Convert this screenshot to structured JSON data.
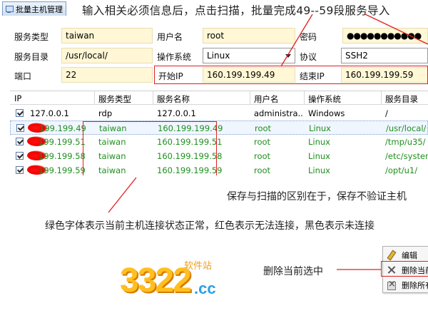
{
  "tab": {
    "label": "批量主机管理"
  },
  "headline": "输入相关必须信息后，点击扫描，批量完成49--59段服务导入",
  "form": {
    "service_type_label": "服务类型",
    "service_type_value": "taiwan",
    "username_label": "用户名",
    "username_value": "root",
    "password_label": "密码",
    "password_value": "●●●●●●●●●●●",
    "service_dir_label": "服务目录",
    "service_dir_value": "/usr/local/",
    "os_label": "操作系统",
    "os_value": "Linux",
    "protocol_label": "协议",
    "protocol_value": "SSH2",
    "port_label": "端口",
    "port_value": "22",
    "start_ip_label": "开始IP",
    "start_ip_value": "160.199.199.49",
    "end_ip_label": "结束IP",
    "end_ip_value": "160.199.199.59"
  },
  "table": {
    "headers": [
      "IP",
      "服务类型",
      "服务名称",
      "用户名",
      "操作系统",
      "服务目录"
    ],
    "rows": [
      {
        "ip": "127.0.0.1",
        "type": "rdp",
        "name": "127.0.0.1",
        "user": "administra...",
        "os": "Windows",
        "dir": "/",
        "green": false,
        "blot": false
      },
      {
        "ip": "199.199.49",
        "type": "taiwan",
        "name": "160.199.199.49",
        "user": "root",
        "os": "Linux",
        "dir": "/usr/local/",
        "green": true,
        "blot": true
      },
      {
        "ip": "199.199.51",
        "type": "taiwan",
        "name": "160.199.199.51",
        "user": "root",
        "os": "Linux",
        "dir": "/tmp/u35/",
        "green": true,
        "blot": true
      },
      {
        "ip": "199.199.58",
        "type": "taiwan",
        "name": "160.199.199.58",
        "user": "root",
        "os": "Linux",
        "dir": "/etc/system",
        "green": true,
        "blot": true
      },
      {
        "ip": "199.199.59",
        "type": "taiwan",
        "name": "160.199.199.59",
        "user": "root",
        "os": "Linux",
        "dir": "/opt/u1/",
        "green": true,
        "blot": true
      }
    ]
  },
  "notes": {
    "save_vs_scan": "保存与扫描的区别在于，保存不验证主机",
    "color_legend": "绿色字体表示当前主机连接状态正常，红色表示无法连接，黑色表示未连接",
    "delete_selected": "删除当前选中"
  },
  "context_menu": {
    "edit": "编辑",
    "delete_current": "删除当前",
    "delete_all": "删除所有"
  },
  "logo": {
    "number": "3322",
    "domain": ".cc",
    "tagline": "软件站"
  },
  "colors": {
    "green_text": "#1f8f1f",
    "annotation_red": "#e02020",
    "field_bg": "#fff7d6"
  }
}
